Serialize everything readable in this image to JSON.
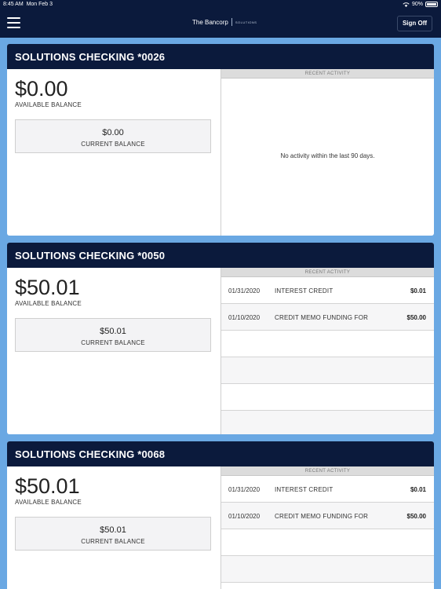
{
  "status": {
    "time": "8:45 AM",
    "date": "Mon Feb 3",
    "battery": "90%"
  },
  "nav": {
    "brand": "The Bancorp",
    "brand_sub": "SOLUTIONS",
    "signoff_label": "Sign Off"
  },
  "accounts": [
    {
      "title": "SOLUTIONS CHECKING *0026",
      "available_balance": "$0.00",
      "available_label": "AVAILABLE BALANCE",
      "current_balance": "$0.00",
      "current_label": "CURRENT BALANCE",
      "activity_header": "RECENT ACTIVITY",
      "empty_message": "No activity within the last 90 days.",
      "transactions": []
    },
    {
      "title": "SOLUTIONS CHECKING *0050",
      "available_balance": "$50.01",
      "available_label": "AVAILABLE BALANCE",
      "current_balance": "$50.01",
      "current_label": "CURRENT BALANCE",
      "activity_header": "RECENT ACTIVITY",
      "transactions": [
        {
          "date": "01/31/2020",
          "description": "INTEREST CREDIT",
          "amount": "$0.01"
        },
        {
          "date": "01/10/2020",
          "description": "CREDIT MEMO FUNDING FOR",
          "amount": "$50.00"
        }
      ]
    },
    {
      "title": "SOLUTIONS CHECKING *0068",
      "available_balance": "$50.01",
      "available_label": "AVAILABLE BALANCE",
      "current_balance": "$50.01",
      "current_label": "CURRENT BALANCE",
      "activity_header": "RECENT ACTIVITY",
      "transactions": [
        {
          "date": "01/31/2020",
          "description": "INTEREST CREDIT",
          "amount": "$0.01"
        },
        {
          "date": "01/10/2020",
          "description": "CREDIT MEMO FUNDING FOR",
          "amount": "$50.00"
        }
      ]
    }
  ]
}
